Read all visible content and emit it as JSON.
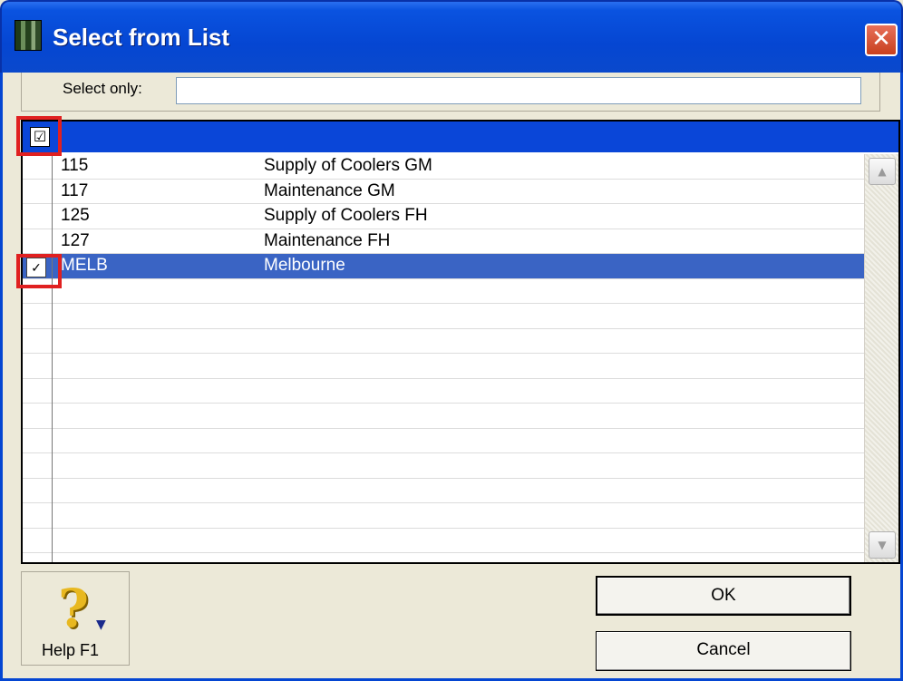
{
  "window": {
    "title": "Select from List",
    "close_glyph": "✕"
  },
  "filter": {
    "label": "Select only:",
    "value": ""
  },
  "grid": {
    "header_check": "☑",
    "rows": [
      {
        "code": "115",
        "description": "Supply of Coolers GM",
        "checked": false,
        "selected": false
      },
      {
        "code": "117",
        "description": "Maintenance GM",
        "checked": false,
        "selected": false
      },
      {
        "code": "125",
        "description": "Supply of Coolers FH",
        "checked": false,
        "selected": false
      },
      {
        "code": "127",
        "description": "Maintenance FH",
        "checked": false,
        "selected": false
      },
      {
        "code": "MELB",
        "description": "Melbourne",
        "checked": true,
        "selected": true
      }
    ],
    "row_check_glyph": "✓",
    "scroll_up_glyph": "▲",
    "scroll_down_glyph": "▼"
  },
  "buttons": {
    "help_glyph": "?",
    "help_arrow": "▼",
    "help_label": "Help F1",
    "ok_label": "OK",
    "cancel_label": "Cancel"
  },
  "colors": {
    "title_bar": "#0546d2",
    "header_bar": "#0a46d8",
    "selection": "#3a64c4",
    "annotation": "#e02020"
  }
}
